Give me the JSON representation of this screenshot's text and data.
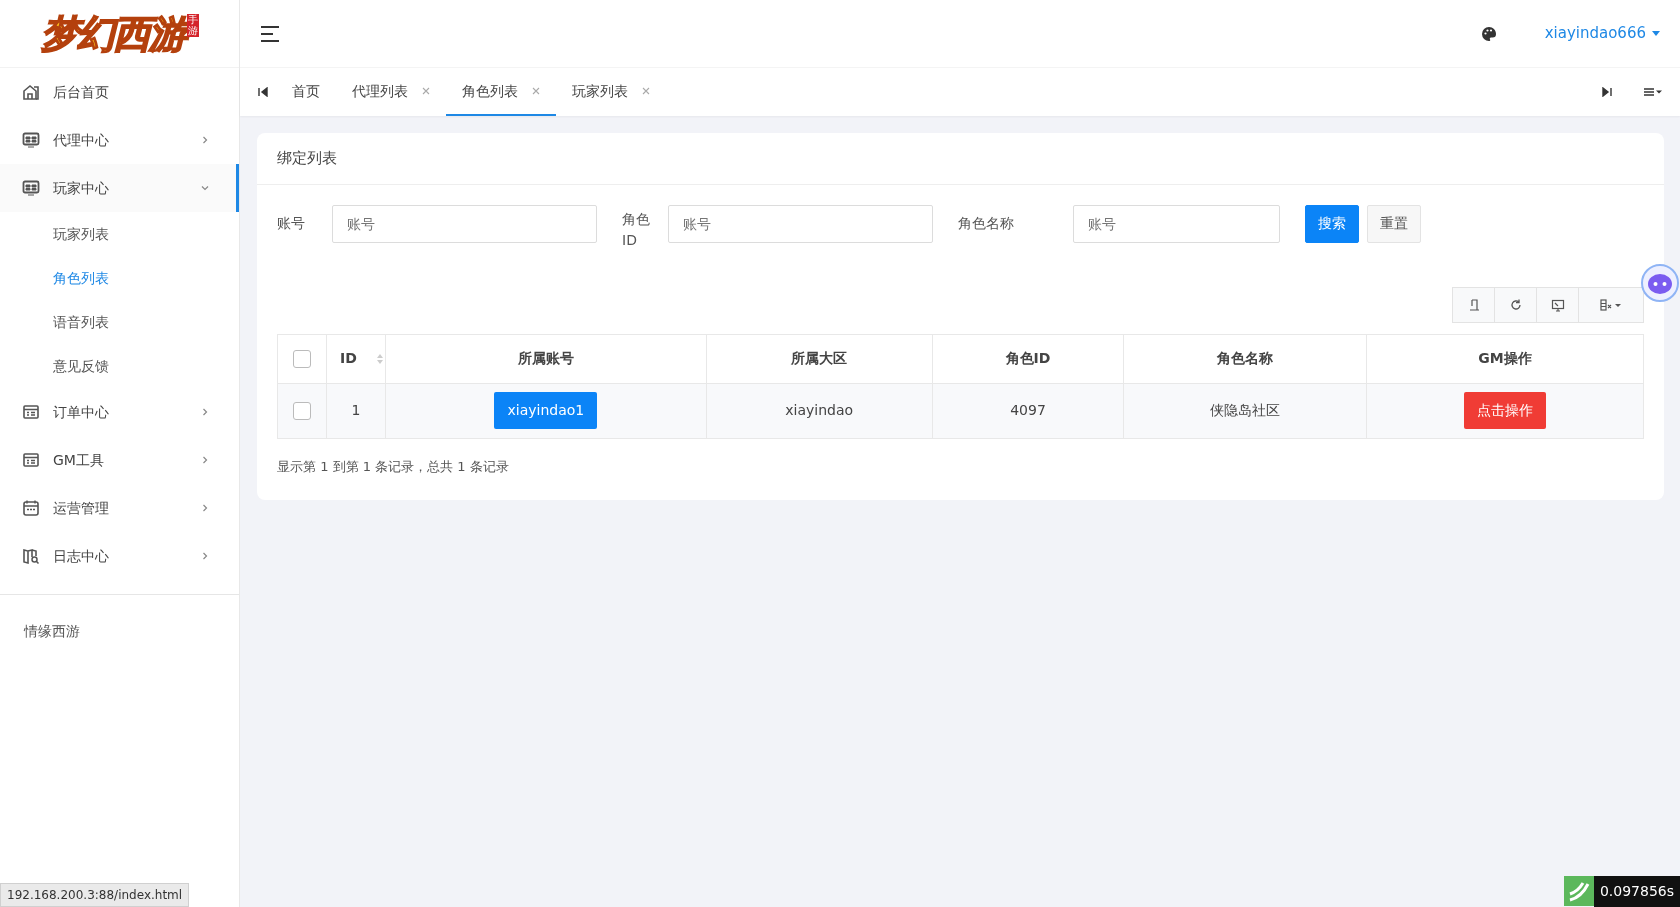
{
  "logo": {
    "text": "梦幻西游",
    "seal": "手游"
  },
  "sidebar": {
    "items": [
      {
        "label": "后台首页",
        "selected": false
      },
      {
        "label": "代理中心",
        "selected": false,
        "expanded": false
      },
      {
        "label": "玩家中心",
        "selected": true,
        "expanded": true,
        "children": [
          {
            "label": "玩家列表",
            "selected": false
          },
          {
            "label": "角色列表",
            "selected": true
          },
          {
            "label": "语音列表",
            "selected": false
          },
          {
            "label": "意见反馈",
            "selected": false
          }
        ]
      },
      {
        "label": "订单中心",
        "selected": false,
        "expanded": false
      },
      {
        "label": "GM工具",
        "selected": false,
        "expanded": false
      },
      {
        "label": "运营管理",
        "selected": false,
        "expanded": false
      },
      {
        "label": "日志中心",
        "selected": false,
        "expanded": false
      }
    ],
    "footer": "情缘西游"
  },
  "header": {
    "username": "xiayindao666"
  },
  "tabs": [
    {
      "label": "首页",
      "closable": false,
      "selected": false
    },
    {
      "label": "代理列表",
      "closable": true,
      "selected": false
    },
    {
      "label": "角色列表",
      "closable": true,
      "selected": true
    },
    {
      "label": "玩家列表",
      "closable": true,
      "selected": false
    }
  ],
  "card": {
    "title": "绑定列表",
    "filters": [
      {
        "label": "账号",
        "placeholder": "账号"
      },
      {
        "label": "角色ID",
        "placeholder": "账号"
      },
      {
        "label": "角色名称",
        "placeholder": "账号"
      }
    ],
    "buttons": [
      {
        "label": "搜索",
        "kind": "primary"
      },
      {
        "label": "重置",
        "kind": "secondary"
      }
    ],
    "table": {
      "columns": [
        {
          "kind": "checkbox",
          "checked": false
        },
        {
          "kind": "text",
          "label": "ID",
          "sortable": true
        },
        {
          "kind": "text",
          "label": "所属账号"
        },
        {
          "kind": "text",
          "label": "所属大区"
        },
        {
          "kind": "text",
          "label": "角色ID"
        },
        {
          "kind": "text",
          "label": "角色名称"
        },
        {
          "kind": "text",
          "label": "GM操作"
        }
      ],
      "rows": [
        {
          "cells": [
            {
              "kind": "checkbox",
              "checked": false
            },
            {
              "kind": "text",
              "text": "1"
            },
            {
              "kind": "primary",
              "text": "xiayindao1"
            },
            {
              "kind": "text",
              "text": "xiayindao"
            },
            {
              "kind": "text",
              "text": "4097"
            },
            {
              "kind": "text",
              "text": "侠隐岛社区"
            },
            {
              "kind": "danger",
              "text": "点击操作"
            }
          ]
        }
      ]
    },
    "summary": "显示第 1 到第 1 条记录，总共 1 条记录"
  },
  "status_url": "192.168.200.3:88/index.html",
  "timer": "0.097856s"
}
